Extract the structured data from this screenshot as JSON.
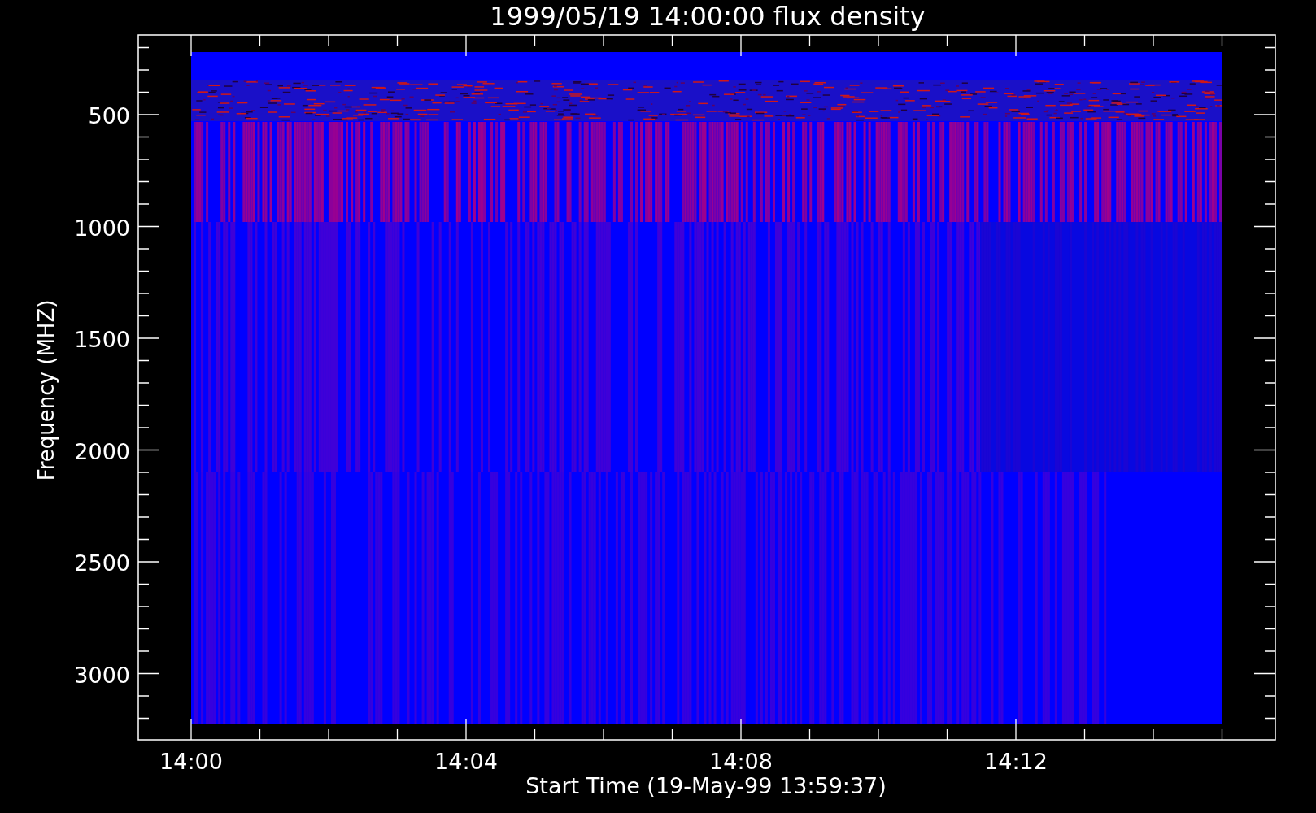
{
  "plot": {
    "title": "1999/05/19 14:00:00 flux density",
    "y_axis": {
      "label": "Frequency (MHZ)",
      "ticks": [
        "500",
        "1000",
        "1500",
        "2000",
        "2500",
        "3000"
      ]
    },
    "x_axis": {
      "label": "Start Time (19-May-99 13:59:37)",
      "ticks": [
        "14:00",
        "14:04",
        "14:08",
        "14:12"
      ]
    }
  }
}
